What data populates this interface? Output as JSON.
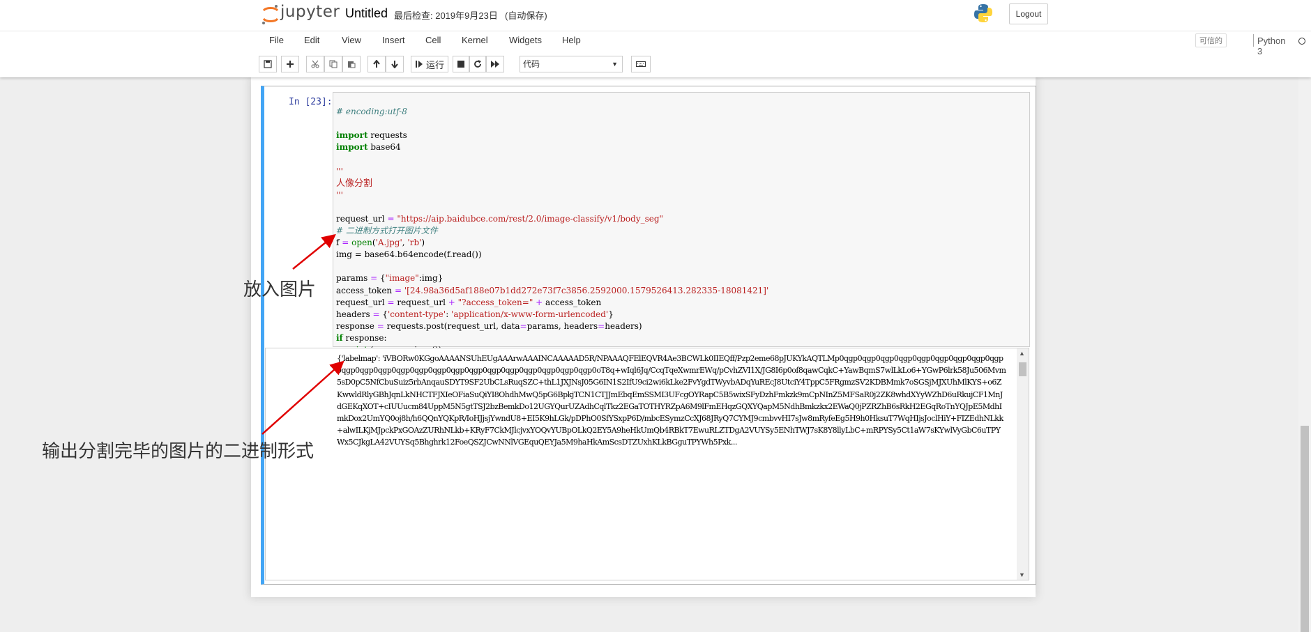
{
  "header": {
    "logo_text": "jupyter",
    "notebook_name": "Untitled",
    "checkpoint": "最后检查: 2019年9月23日",
    "autosave": "(自动保存)",
    "logout_label": "Logout"
  },
  "menu": {
    "items": [
      "File",
      "Edit",
      "View",
      "Insert",
      "Cell",
      "Kernel",
      "Widgets",
      "Help"
    ],
    "trusted_label": "可信的",
    "kernel_name": "Python 3"
  },
  "toolbar": {
    "run_label": "运行",
    "cell_type": "代码",
    "icons": [
      "save-icon",
      "plus-icon",
      "cut-icon",
      "copy-icon",
      "paste-icon",
      "arrow-up-icon",
      "arrow-down-icon",
      "run-icon",
      "stop-icon",
      "restart-icon",
      "fast-forward-icon",
      "keyboard-icon"
    ]
  },
  "cell": {
    "prompt": "In [23]:",
    "code": {
      "l1": "# encoding:utf-8",
      "l3_kw": "import",
      "l3_mod": " requests",
      "l4_kw": "import",
      "l4_mod": " base64",
      "l6": "'''",
      "l7": "人像分割",
      "l8": "'''",
      "l10_a": "request_url ",
      "l10_op": "=",
      "l10_s": " \"https://aip.baidubce.com/rest/2.0/image-classify/v1/body_seg\"",
      "l11": "# 二进制方式打开图片文件",
      "l12_a": "f ",
      "l12_op": "=",
      "l12_b": " ",
      "l12_fn": "open",
      "l12_c": "(",
      "l12_s1": "'A.jpg'",
      "l12_d": ", ",
      "l12_s2": "'rb'",
      "l12_e": ")",
      "l13": "img = base64.b64encode(f.read())",
      "l15_a": "params ",
      "l15_op": "=",
      "l15_b": " {",
      "l15_s": "\"image\"",
      "l15_c": ":img}",
      "l16_a": "access_token ",
      "l16_op": "=",
      "l16_b": " ",
      "l16_s": "'[24.98a36d5af188e07b1dd272e73f7c3856.2592000.1579526413.282335-18081421]'",
      "l17_a": "request_url ",
      "l17_op": "=",
      "l17_b": " request_url ",
      "l17_op2": "+",
      "l17_s": " \"?access_token=\" ",
      "l17_op3": "+",
      "l17_c": " access_token",
      "l18_a": "headers ",
      "l18_op": "=",
      "l18_b": " {",
      "l18_s1": "'content-type'",
      "l18_c": ": ",
      "l18_s2": "'application/x-www-form-urlencoded'",
      "l18_d": "}",
      "l19_a": "response ",
      "l19_op": "=",
      "l19_b": " requests.post(request_url, data",
      "l19_op2": "=",
      "l19_c": "params, headers",
      "l19_op3": "=",
      "l19_d": "headers)",
      "l20_kw": "if",
      "l20_b": " response:",
      "l21_kw": "print",
      "l21_b": " (response.json())"
    },
    "output": "{'labelmap': 'iVBORw0KGgoAAAANSUhEUgAAArwAAAINCAAAAAD5R/NPAAAQFElEQVR4Ae3BCWLk0IIEQff/Pzp2eme68pJUKYkAQTLMp0qgp0qgp0qgp0qgp0qgp0qgp0qgp0qgp0qgp0qgp0qgp0qgp0qgp0qgp0qgp0qgp0qgp0qgp0qgp0qgp0qgp0qgp0qgp0oT8q+wIql6Jq/CcqTqeXwmrEWq/pCvhZVI1X/JG8I6p0of8qawCqkC+YawBqmS7wlLkLo6+YGwP6lrk58Ju506Mvm5sD0pC5NfCbuSuiz5rbAnqauSDYT9SF2UbCLsRuqSZC+thL1JXJNsJ05G6IN1S2IfU9ci2wi6kLke2FvYgdTWyvbADqYuREcJ8UtciY4TppC5FRgmzSV2KDBMmk7oSGSjMJXUhMlKYS+o6ZKwwldRlyGBhJqnLkNHCTFJXIeOFiaSuQiYI8OhdhMwQ5pG6BpkjTCN1CTJJmEbqEmSSMI3UFcgOYRapC5B5wixSFyDzhFmkzk9mCpNInZ5MFSaR0j2ZK8whdXYyWZhD6uRkujCF1MnJdGEKqXOT+cIUUucm84UppM5N5gtTSJ2bzBemkDo12UGYQurUZAdhCqlTkz2EGaTOTHYRZpA6M9lFmEHqzGQXYQapM5NdhBmkzkx2EWaQ0jPZRZhB6sRkH2EGqRoTnYQJpE5MdhImkDox2UmYQ0oj8h/h6QQnYQKpR/IoHJjsjYwndU8+EI5K9hLGk/pDPhO0SfYSxpP6D/mbcESymzCcXJ68JRyQ7CYMJ9cmbvvHI7sJw8mRyfeEg5H9h0HksuT7WqHIjsJoclHiY+FIZEdhNLkk+alwILKjMJpckPxGOAzZURhNLkb+KRyF7CkMJlcjvxYOQvYUBpOLkQ2EY5A9heHkUmQb4RBkT7EwuRLZTDgA2VUYSy5ENhTWJ7sK8Y8llyLbC+mRPYSy5Ct1aW7sKYwlVyGbC6uTPYWx5CJkgLA42VUYSq5Bhghrk12FoeQSZJCwNNlVGEquQEYJa5M9haHkAmScsDTZUxhKLkBGguTPYWh5Pxk..."
  },
  "annotations": {
    "put_image": "放入图片",
    "output_binary": "输出分割完毕的图片的二进制形式"
  },
  "colors": {
    "cell_border_active": "#42a5f5",
    "prompt": "#303f9f",
    "comment": "#408080",
    "keyword": "#008000",
    "string": "#ba2121",
    "operator": "#aa22ff",
    "arrow": "#e00000"
  }
}
